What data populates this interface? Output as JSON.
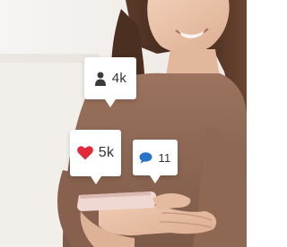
{
  "notifications": {
    "followers": {
      "icon": "person-icon",
      "count": "4k"
    },
    "likes": {
      "icon": "heart-icon",
      "count": "5k"
    },
    "comments": {
      "icon": "speech-bubble-icon",
      "count": "11"
    }
  },
  "colors": {
    "heart": "#e02a3a",
    "comment": "#2a72c8",
    "person": "#3a3a3a",
    "bubble_bg": "#ffffff",
    "sweater": "#8a6552",
    "skin": "#e9c4ab",
    "hair": "#4a2e22",
    "phone": "#e8c8c4"
  }
}
